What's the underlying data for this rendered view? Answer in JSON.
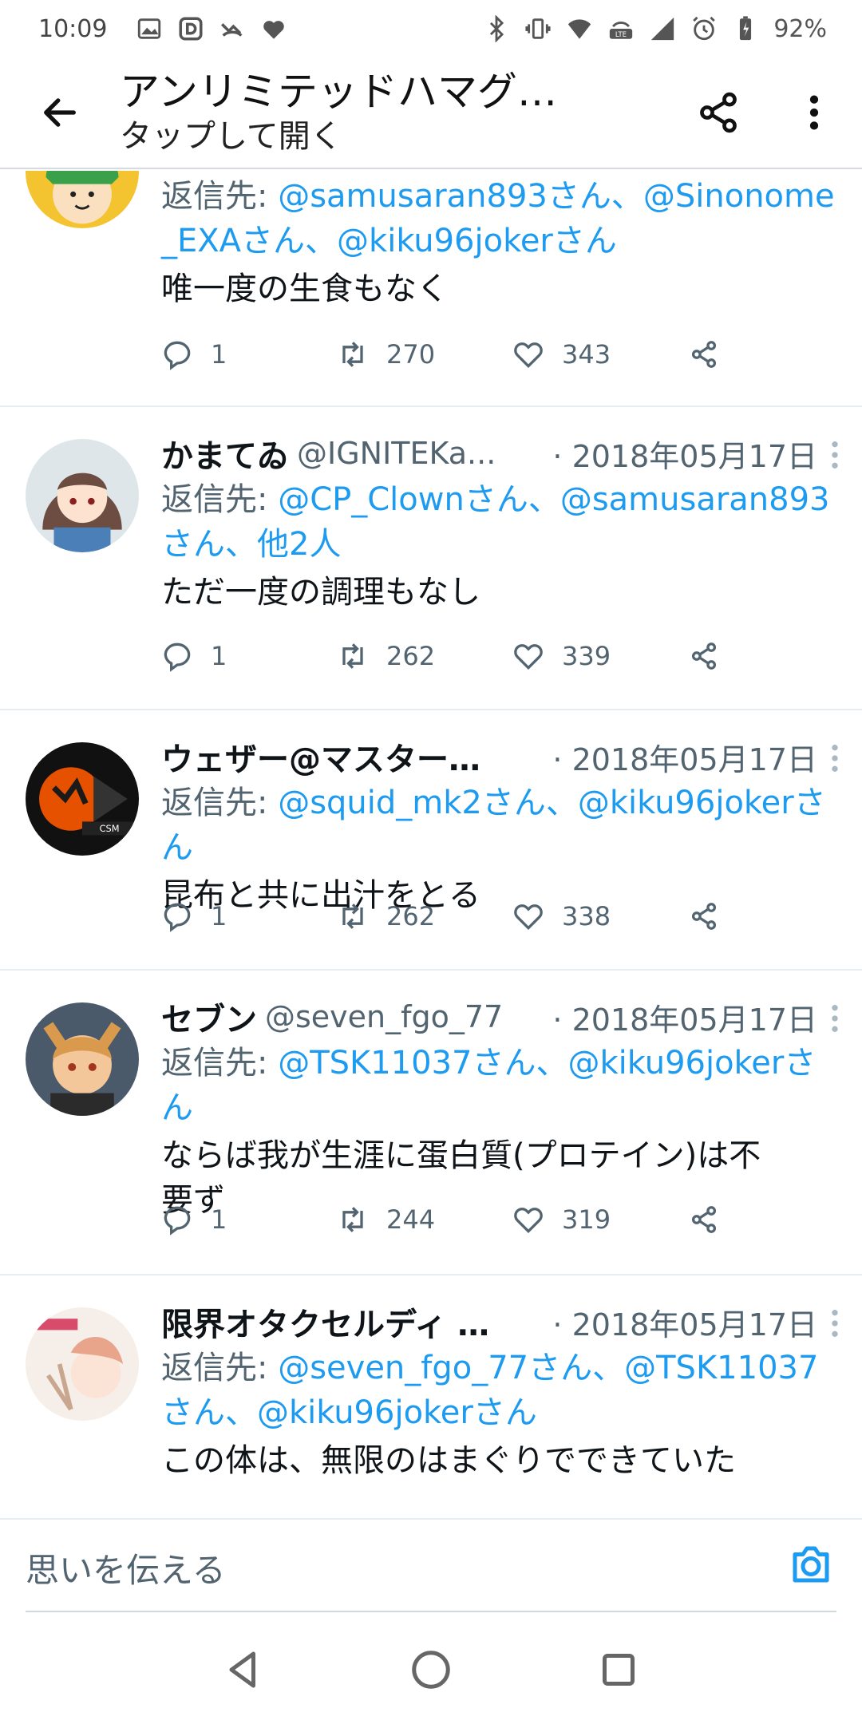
{
  "status_bar": {
    "time": "10:09",
    "battery": "92%"
  },
  "app_bar": {
    "title": "アンリミテッドハマグ…",
    "subtitle": "タップして開く"
  },
  "tweets": [
    {
      "name": "",
      "handle": "",
      "date": "",
      "reply_label": "返信先:",
      "reply_mentions": "@samusaran893さん、@Sinonome_EXAさん、@kiku96jokerさん",
      "text": "唯一度の生食もなく",
      "replies": "1",
      "retweets": "270",
      "likes": "343"
    },
    {
      "name": "かまてゐ",
      "handle": "@IGNITEKa...",
      "date": "· 2018年05月17日",
      "reply_label": "返信先:",
      "reply_mentions": "@CP_Clownさん、@samusaran893さん、他2人",
      "text": "ただ一度の調理もなし",
      "replies": "1",
      "retweets": "262",
      "likes": "339"
    },
    {
      "name": "ウェザー@マスター…",
      "handle": "",
      "date": "· 2018年05月17日",
      "reply_label": "返信先:",
      "reply_mentions": "@squid_mk2さん、@kiku96jokerさん",
      "text": "昆布と共に出汁をとる",
      "replies": "1",
      "retweets": "262",
      "likes": "338"
    },
    {
      "name": "セブン",
      "handle": "@seven_fgo_77",
      "date": "· 2018年05月17日",
      "reply_label": "返信先:",
      "reply_mentions": "@TSK11037さん、@kiku96jokerさん",
      "text": "ならば我が生涯に蛋白質(プロテイン)は不要ず",
      "replies": "1",
      "retweets": "244",
      "likes": "319"
    },
    {
      "name": "限界オタクセルディ …",
      "handle": "",
      "date": "· 2018年05月17日",
      "reply_label": "返信先:",
      "reply_mentions": "@seven_fgo_77さん、@TSK11037さん、@kiku96jokerさん",
      "text": "この体は、無限のはまぐりでできていた",
      "replies": "",
      "retweets": "",
      "likes": ""
    }
  ],
  "compose": {
    "placeholder": "思いを伝える"
  }
}
